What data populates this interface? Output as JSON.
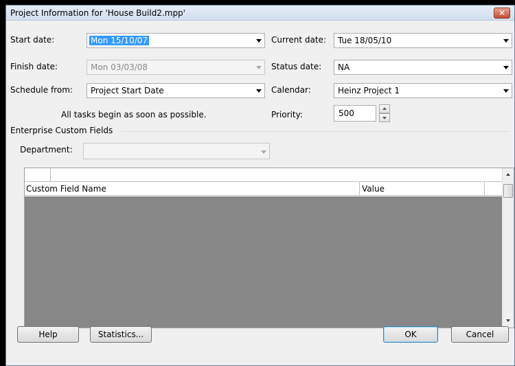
{
  "window": {
    "title": "Project Information for 'House Build2.mpp'",
    "close_glyph": "✕"
  },
  "fields": {
    "start_date": {
      "label": "Start date:",
      "value": "Mon 15/10/07"
    },
    "finish_date": {
      "label": "Finish date:",
      "value": "Mon 03/03/08"
    },
    "schedule_from": {
      "label": "Schedule from:",
      "value": "Project Start Date"
    },
    "schedule_note": "All tasks begin as soon as possible.",
    "current_date": {
      "label": "Current date:",
      "value": "Tue 18/05/10"
    },
    "status_date": {
      "label": "Status date:",
      "value": "NA"
    },
    "calendar": {
      "label": "Calendar:",
      "value": "Heinz Project 1"
    },
    "priority": {
      "label": "Priority:",
      "value": "500"
    }
  },
  "enterprise": {
    "section_title": "Enterprise Custom Fields",
    "department": {
      "label": "Department:",
      "value": ""
    },
    "grid": {
      "columns": [
        "Custom Field Name",
        "Value"
      ],
      "rows": []
    }
  },
  "buttons": {
    "help": "Help",
    "statistics": "Statistics...",
    "ok": "OK",
    "cancel": "Cancel"
  },
  "icons": [
    "close-icon",
    "dropdown-arrow-icon",
    "spin-up-icon",
    "spin-down-icon",
    "scroll-up-icon",
    "scroll-down-icon"
  ],
  "colors": {
    "selection": "#3399ff",
    "dialog_bg": "#f0f0f0",
    "grid_body": "#878787",
    "close_button": "#c64b33"
  }
}
